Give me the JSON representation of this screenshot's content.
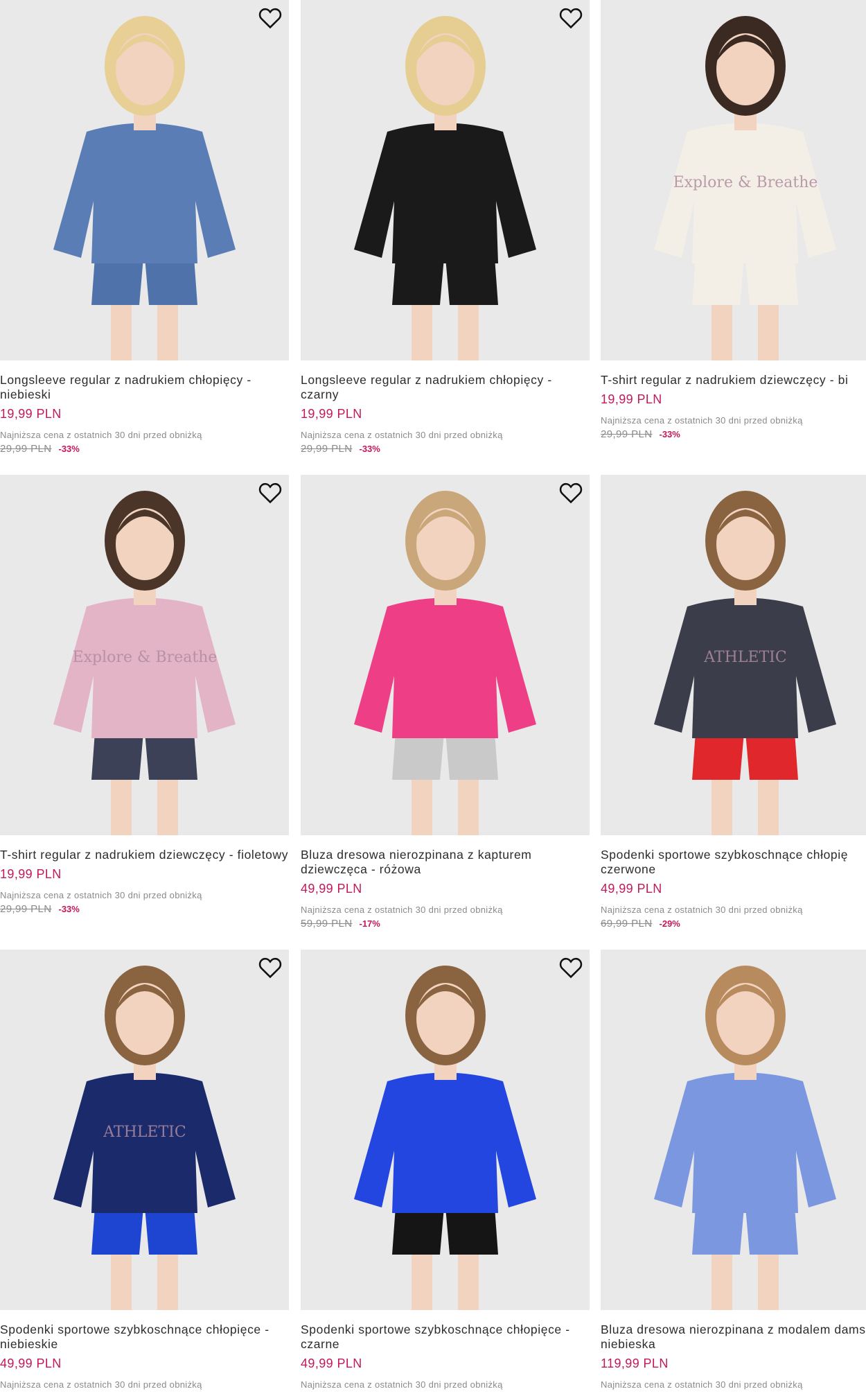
{
  "lowest_price_label": "Najniższa cena z ostatnich 30 dni przed obniżką",
  "products": [
    {
      "title": "Longsleeve regular z nadrukiem chłopięcy - niebieski",
      "price": "19,99 PLN",
      "old_price": "29,99 PLN",
      "discount": "-33%",
      "garment_color": "#5a7db5",
      "bottom_color": "#4f72ab",
      "hair_color": "#e8cf95",
      "print_text": ""
    },
    {
      "title": "Longsleeve regular z nadrukiem chłopięcy - czarny",
      "price": "19,99 PLN",
      "old_price": "29,99 PLN",
      "discount": "-33%",
      "garment_color": "#1a1a1a",
      "bottom_color": "#1a1a1a",
      "hair_color": "#e6cd92",
      "print_text": ""
    },
    {
      "title": "T-shirt regular z nadrukiem dziewczęcy - bi",
      "price": "19,99 PLN",
      "old_price": "29,99 PLN",
      "discount": "-33%",
      "garment_color": "#f4efe6",
      "bottom_color": "#f4efe6",
      "hair_color": "#3a2a22",
      "print_text": "Explore & Breathe"
    },
    {
      "title": "T-shirt regular z nadrukiem dziewczęcy - fioletowy",
      "price": "19,99 PLN",
      "old_price": "29,99 PLN",
      "discount": "-33%",
      "garment_color": "#e3b3c6",
      "bottom_color": "#3c4157",
      "hair_color": "#4a3528",
      "print_text": "Explore & Breathe"
    },
    {
      "title": "Bluza dresowa nierozpinana z kapturem dziewczęca - różowa",
      "price": "49,99 PLN",
      "old_price": "59,99 PLN",
      "discount": "-17%",
      "garment_color": "#ee3f86",
      "bottom_color": "#c9c9c9",
      "hair_color": "#c9a77a",
      "print_text": ""
    },
    {
      "title": "Spodenki sportowe szybkoschnące chłopię czerwone",
      "price": "49,99 PLN",
      "old_price": "69,99 PLN",
      "discount": "-29%",
      "garment_color": "#3b3d4a",
      "bottom_color": "#e0282c",
      "hair_color": "#8a6440",
      "print_text": "ATHLETIC"
    },
    {
      "title": "Spodenki sportowe szybkoschnące chłopięce - niebieskie",
      "price": "49,99 PLN",
      "old_price": "",
      "discount": "",
      "garment_color": "#1b2a6b",
      "bottom_color": "#1e45d1",
      "hair_color": "#8a6440",
      "print_text": "ATHLETIC"
    },
    {
      "title": "Spodenki sportowe szybkoschnące chłopięce - czarne",
      "price": "49,99 PLN",
      "old_price": "",
      "discount": "",
      "garment_color": "#2345e0",
      "bottom_color": "#151515",
      "hair_color": "#8a6440",
      "print_text": ""
    },
    {
      "title": "Bluza dresowa nierozpinana z modalem damska - niebieska",
      "price": "119,99 PLN",
      "old_price": "",
      "discount": "",
      "garment_color": "#7a97e0",
      "bottom_color": "#7a97e0",
      "hair_color": "#b88b5e",
      "print_text": ""
    }
  ]
}
